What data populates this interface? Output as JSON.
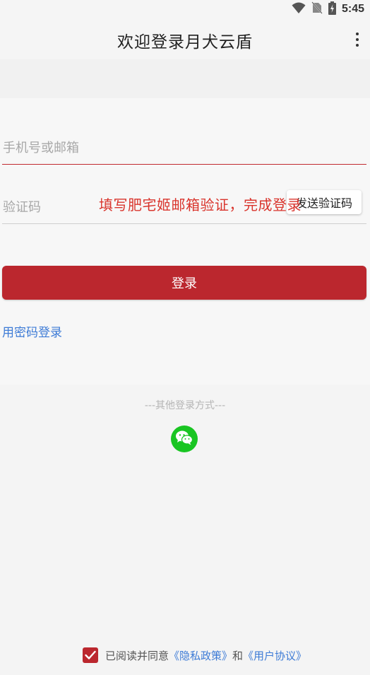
{
  "status_bar": {
    "time": "5:45",
    "icons": [
      "wifi-icon",
      "no-sim-icon",
      "battery-charging-icon"
    ]
  },
  "app_bar": {
    "title": "欢迎登录月犬云盾",
    "menu_icon": "more-vert-icon"
  },
  "form": {
    "phone_placeholder": "手机号或邮箱",
    "code_placeholder": "验证码",
    "send_code_label": "发送验证码",
    "overlay_hint": "填写肥宅姬邮箱验证，完成登录",
    "login_label": "登录",
    "password_login_label": "用密码登录"
  },
  "other_login": {
    "label": "---其他登录方式---",
    "providers": [
      "wechat-icon"
    ]
  },
  "agreement": {
    "checked": true,
    "prefix": "已阅读并同意",
    "privacy_link": "《隐私政策》",
    "and": "和",
    "terms_link": "《用户协议》"
  },
  "colors": {
    "accent": "#bb272e",
    "link": "#3d7bd6",
    "wechat": "#19c522"
  }
}
